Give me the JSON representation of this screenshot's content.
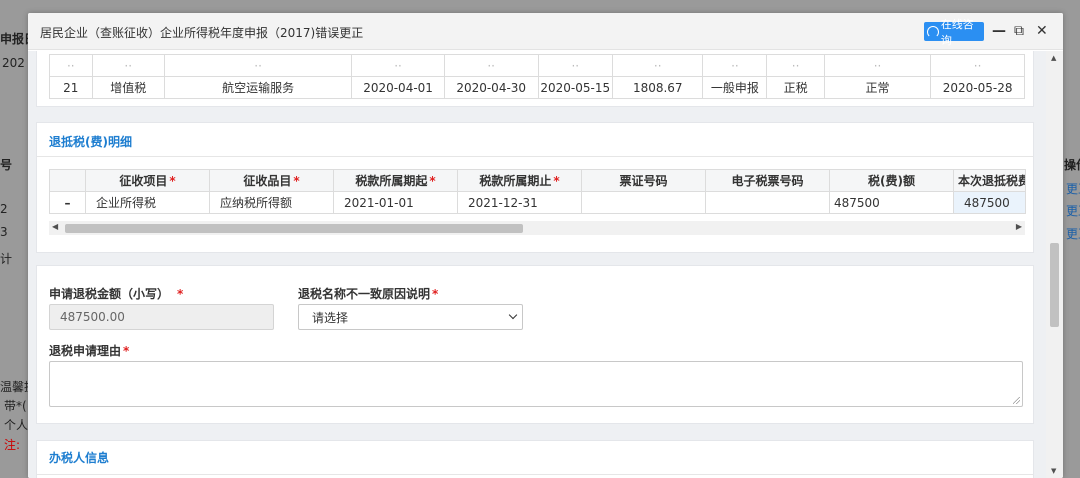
{
  "background": {
    "fragments": [
      "申报日",
      "202",
      "号",
      "2",
      "3",
      "计",
      "温馨提",
      "带*(",
      "个人",
      "注:",
      "操作",
      "更正",
      "更正",
      "更正"
    ]
  },
  "modal": {
    "title": "居民企业（查账征收）企业所得税年度申报（2017)错误更正",
    "consult_label": "在线咨询",
    "minimize_glyph": "—",
    "restore_glyph": "⧉",
    "close_glyph": "✕"
  },
  "prev_table": {
    "rows": [
      {
        "no": "21",
        "tax": "增值税",
        "item": "航空运输服务",
        "start": "2020-04-01",
        "end": "2020-04-30",
        "date": "2020-05-15",
        "amount": "1808.67",
        "type": "一般申报",
        "kind": "正税",
        "status": "正常",
        "pay_date": "2020-05-28"
      }
    ]
  },
  "refund": {
    "title": "退抵税(费)明细",
    "headers": [
      "征收项目",
      "征收品目",
      "税款所属期起",
      "税款所属期止",
      "票证号码",
      "电子税票号码",
      "税(费)额",
      "本次退抵税费"
    ],
    "required": [
      true,
      true,
      true,
      true,
      false,
      false,
      false,
      false
    ],
    "rows": [
      {
        "minus": "–",
        "project": "企业所得税",
        "item": "应纳税所得额",
        "start": "2021-01-01",
        "end": "2021-12-31",
        "ticket": "",
        "eticket": "",
        "amount": "487500",
        "refund": "487500"
      }
    ]
  },
  "form": {
    "amount_label": "申请退税金额（小写）",
    "amount_value": "487500.00",
    "reason_name_label": "退税名称不一致原因说明",
    "reason_name_value": "请选择",
    "reason_label": "退税申请理由"
  },
  "agent": {
    "title": "办税人信息"
  },
  "colors": {
    "accent": "#1e7ed0",
    "consult_bg": "#2b8ff2",
    "required": "#e02020"
  }
}
